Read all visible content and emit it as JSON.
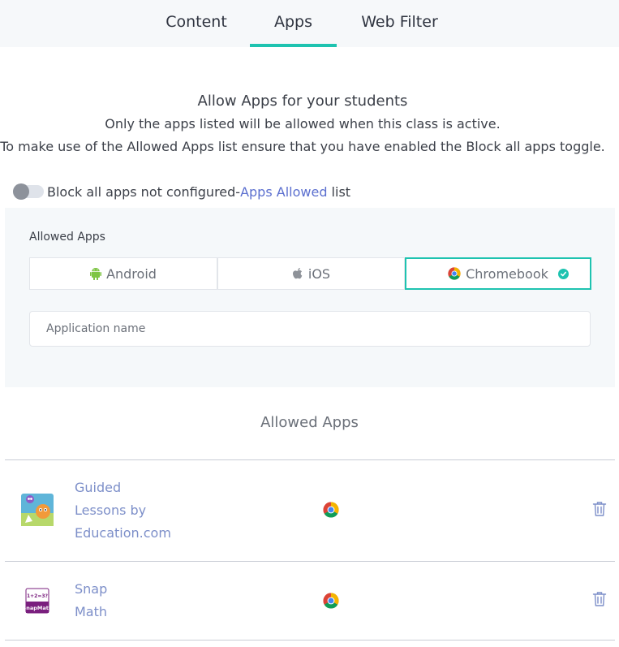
{
  "tabs": {
    "content": "Content",
    "apps": "Apps",
    "web_filter": "Web Filter",
    "active": "Apps"
  },
  "intro": {
    "title": "Allow Apps for your students",
    "line1": "Only the apps listed will be allowed when this class is active.",
    "line2": "To make use of the Allowed Apps list ensure that you have enabled the Block all apps toggle."
  },
  "block_toggle": {
    "on": false,
    "label_prefix": "Block all apps not configured-",
    "link_text": "Apps Allowed",
    "label_suffix": " list"
  },
  "panel": {
    "label": "Allowed Apps",
    "platforms": {
      "android": "Android",
      "ios": "iOS",
      "chromebook": "Chromebook"
    },
    "selected_platform": "Chromebook",
    "search_placeholder": "Application name",
    "search_value": ""
  },
  "allowed_list": {
    "title": "Allowed Apps",
    "apps": [
      {
        "name_lines": [
          "Guided",
          "Lessons by",
          "Education.com"
        ],
        "platform_icon": "chrome-icon",
        "icon": "guided-lessons-icon"
      },
      {
        "name_lines": [
          "Snap",
          "Math"
        ],
        "platform_icon": "chrome-icon",
        "icon": "snap-math-icon"
      }
    ]
  },
  "colors": {
    "accent": "#1ec3b0",
    "link": "#5b6fcf",
    "app_name": "#7d8fc9"
  }
}
